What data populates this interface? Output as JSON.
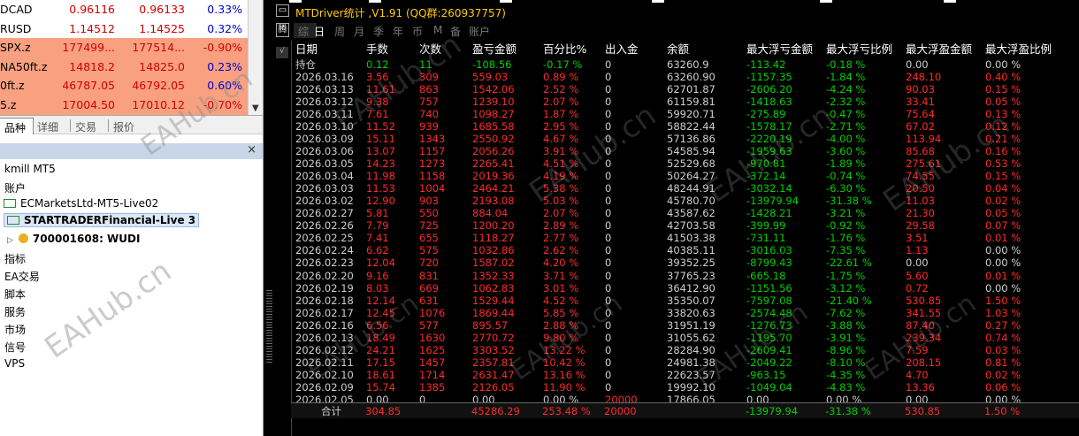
{
  "market_watch": {
    "rows": [
      {
        "symbol": "DCAD",
        "bid": "0.96116",
        "ask": "0.96133",
        "change": "0.33%",
        "negative": false
      },
      {
        "symbol": "RUSD",
        "bid": "1.14512",
        "ask": "1.14525",
        "change": "0.32%",
        "negative": false
      },
      {
        "symbol": "SPX.z",
        "bid": "177499...",
        "ask": "177514...",
        "change": "-0.90%",
        "negative": true
      },
      {
        "symbol": "NA50ft.z",
        "bid": "14818.2",
        "ask": "14825.0",
        "change": "0.23%",
        "negative": true
      },
      {
        "symbol": "0ft.z",
        "bid": "46787.05",
        "ask": "46792.05",
        "change": "0.60%",
        "negative": true
      },
      {
        "symbol": "5.z",
        "bid": "17004.50",
        "ask": "17010.12",
        "change": "-0.70%",
        "negative": true
      }
    ],
    "tabs": [
      "品种",
      "详细",
      "交易",
      "报价"
    ]
  },
  "navigator": {
    "close_label": "×",
    "items": {
      "broker": "kmill MT5",
      "accounts": "账户",
      "account1": "ECMarketsLtd-MT5-Live02",
      "account2": "STARTRADERFinancial-Live 3",
      "user": "700001608: WUDI",
      "indicators": "指标",
      "ea": "EA交易",
      "scripts": "脚本",
      "services": "服务",
      "market": "市场",
      "signals": "信号",
      "vps": "VPS"
    }
  },
  "stats_panel": {
    "title": "MTDriver统计 ,V1.91 (QQ群:260937757)",
    "minimize_label": "▭",
    "side_label": "√",
    "tabs": {
      "boxed": "腾",
      "items": [
        "综",
        "日",
        "周",
        "月",
        "季",
        "年",
        "币",
        "M",
        "备",
        "账户"
      ],
      "selected": "日"
    },
    "headers": [
      "日期",
      "手数",
      "次数",
      "盈亏金额",
      "百分比%",
      "出入金",
      "余额",
      "最大浮亏金额",
      "最大浮亏比例",
      "最大浮盈金额",
      "最大浮盈比例"
    ],
    "rows": [
      [
        "持仓",
        "0.12",
        "11",
        "-108.56",
        "-0.17 %",
        "0",
        "63260.9",
        "-113.42",
        "-0.18 %",
        "0.00",
        "0.00 %"
      ],
      [
        "2026.03.16",
        "3.56",
        "309",
        "559.03",
        "0.89 %",
        "0",
        "63260.90",
        "-1157.35",
        "-1.84 %",
        "248.10",
        "0.40 %"
      ],
      [
        "2026.03.13",
        "11.61",
        "863",
        "1542.06",
        "2.52 %",
        "0",
        "62701.87",
        "-2606.20",
        "-4.24 %",
        "90.03",
        "0.15 %"
      ],
      [
        "2026.03.12",
        "9.38",
        "757",
        "1239.10",
        "2.07 %",
        "0",
        "61159.81",
        "-1418.63",
        "-2.32 %",
        "33.41",
        "0.05 %"
      ],
      [
        "2026.03.11",
        "7.61",
        "740",
        "1098.27",
        "1.87 %",
        "0",
        "59920.71",
        "-275.89",
        "-0.47 %",
        "75.64",
        "0.13 %"
      ],
      [
        "2026.03.10",
        "11.52",
        "939",
        "1685.58",
        "2.95 %",
        "0",
        "58822.44",
        "-1578.17",
        "-2.71 %",
        "67.02",
        "0.12 %"
      ],
      [
        "2026.03.09",
        "15.11",
        "1343",
        "2550.92",
        "4.67 %",
        "0",
        "57136.86",
        "-2220.19",
        "-4.00 %",
        "113.94",
        "0.21 %"
      ],
      [
        "2026.03.06",
        "13.07",
        "1157",
        "2056.26",
        "3.91 %",
        "0",
        "54585.94",
        "-1959.63",
        "-3.60 %",
        "85.68",
        "0.16 %"
      ],
      [
        "2026.03.05",
        "14.23",
        "1273",
        "2265.41",
        "4.51 %",
        "0",
        "52529.68",
        "-970.81",
        "-1.89 %",
        "275.61",
        "0.53 %"
      ],
      [
        "2026.03.04",
        "11.98",
        "1158",
        "2019.36",
        "4.19 %",
        "0",
        "50264.27",
        "-372.14",
        "-0.74 %",
        "74.55",
        "0.15 %"
      ],
      [
        "2026.03.03",
        "11.53",
        "1004",
        "2464.21",
        "5.38 %",
        "0",
        "48244.91",
        "-3032.14",
        "-6.30 %",
        "20.50",
        "0.04 %"
      ],
      [
        "2026.03.02",
        "12.90",
        "903",
        "2193.08",
        "5.03 %",
        "0",
        "45780.70",
        "-13979.94",
        "-31.38 %",
        "11.03",
        "0.02 %"
      ],
      [
        "2026.02.27",
        "5.81",
        "550",
        "884.04",
        "2.07 %",
        "0",
        "43587.62",
        "-1428.21",
        "-3.21 %",
        "21.30",
        "0.05 %"
      ],
      [
        "2026.02.26",
        "7.79",
        "725",
        "1200.20",
        "2.89 %",
        "0",
        "42703.58",
        "-399.99",
        "-0.92 %",
        "29.58",
        "0.07 %"
      ],
      [
        "2026.02.25",
        "7.41",
        "655",
        "1118.27",
        "2.77 %",
        "0",
        "41503.38",
        "-731.11",
        "-1.76 %",
        "3.51",
        "0.01 %"
      ],
      [
        "2026.02.24",
        "6.62",
        "575",
        "1032.86",
        "2.62 %",
        "0",
        "40385.11",
        "-3016.03",
        "-7.35 %",
        "1.13",
        "0.00 %"
      ],
      [
        "2026.02.23",
        "12.04",
        "720",
        "1587.02",
        "4.20 %",
        "0",
        "39352.25",
        "-8799.43",
        "-22.61 %",
        "0.00",
        "0.00 %"
      ],
      [
        "2026.02.20",
        "9.16",
        "831",
        "1352.33",
        "3.71 %",
        "0",
        "37765.23",
        "-665.18",
        "-1.75 %",
        "5.60",
        "0.01 %"
      ],
      [
        "2026.02.19",
        "8.03",
        "669",
        "1062.83",
        "3.01 %",
        "0",
        "36412.90",
        "-1151.56",
        "-3.12 %",
        "0.72",
        "0.00 %"
      ],
      [
        "2026.02.18",
        "12.14",
        "631",
        "1529.44",
        "4.52 %",
        "0",
        "35350.07",
        "-7597.08",
        "-21.40 %",
        "530.85",
        "1.50 %"
      ],
      [
        "2026.02.17",
        "12.45",
        "1076",
        "1869.44",
        "5.85 %",
        "0",
        "33820.63",
        "-2574.48",
        "-7.62 %",
        "341.55",
        "1.03 %"
      ],
      [
        "2026.02.16",
        "6.56",
        "577",
        "895.57",
        "2.88 %",
        "0",
        "31951.19",
        "-1276.73",
        "-3.88 %",
        "87.40",
        "0.27 %"
      ],
      [
        "2026.02.13",
        "18.49",
        "1630",
        "2770.72",
        "9.80 %",
        "0",
        "31055.62",
        "-1195.70",
        "-3.91 %",
        "239.34",
        "0.74 %"
      ],
      [
        "2026.02.12",
        "24.21",
        "1625",
        "3303.52",
        "13.22 %",
        "0",
        "28284.90",
        "-2609.41",
        "-8.96 %",
        "7.59",
        "0.03 %"
      ],
      [
        "2026.02.11",
        "17.15",
        "1457",
        "2357.81",
        "10.42 %",
        "0",
        "24981.38",
        "-2049.22",
        "-8.10 %",
        "208.15",
        "0.81 %"
      ],
      [
        "2026.02.10",
        "18.61",
        "1714",
        "2631.47",
        "13.16 %",
        "0",
        "22623.57",
        "-963.15",
        "-4.35 %",
        "4.70",
        "0.02 %"
      ],
      [
        "2026.02.09",
        "15.74",
        "1385",
        "2126.05",
        "11.90 %",
        "0",
        "19992.10",
        "-1049.04",
        "-4.83 %",
        "13.36",
        "0.06 %"
      ],
      [
        "2026.02.05",
        "0.00",
        "0",
        "0.00",
        "0.00 %",
        "20000",
        "17866.05",
        "0.00",
        "0.00 %",
        "0.00",
        "0.00 %"
      ]
    ],
    "summary": [
      "合计",
      "304.85",
      "",
      "45286.29",
      "253.48 %",
      "20000",
      "",
      "-13979.94",
      "-31.38 %",
      "530.85",
      "1.50 %"
    ]
  },
  "watermark": "EAHub.cn",
  "colors": {
    "profit_red": "#ff2a2a",
    "loss_green": "#00d000",
    "title_yellow": "#ffcc00",
    "quote_negative_bg": "#f8a080"
  }
}
